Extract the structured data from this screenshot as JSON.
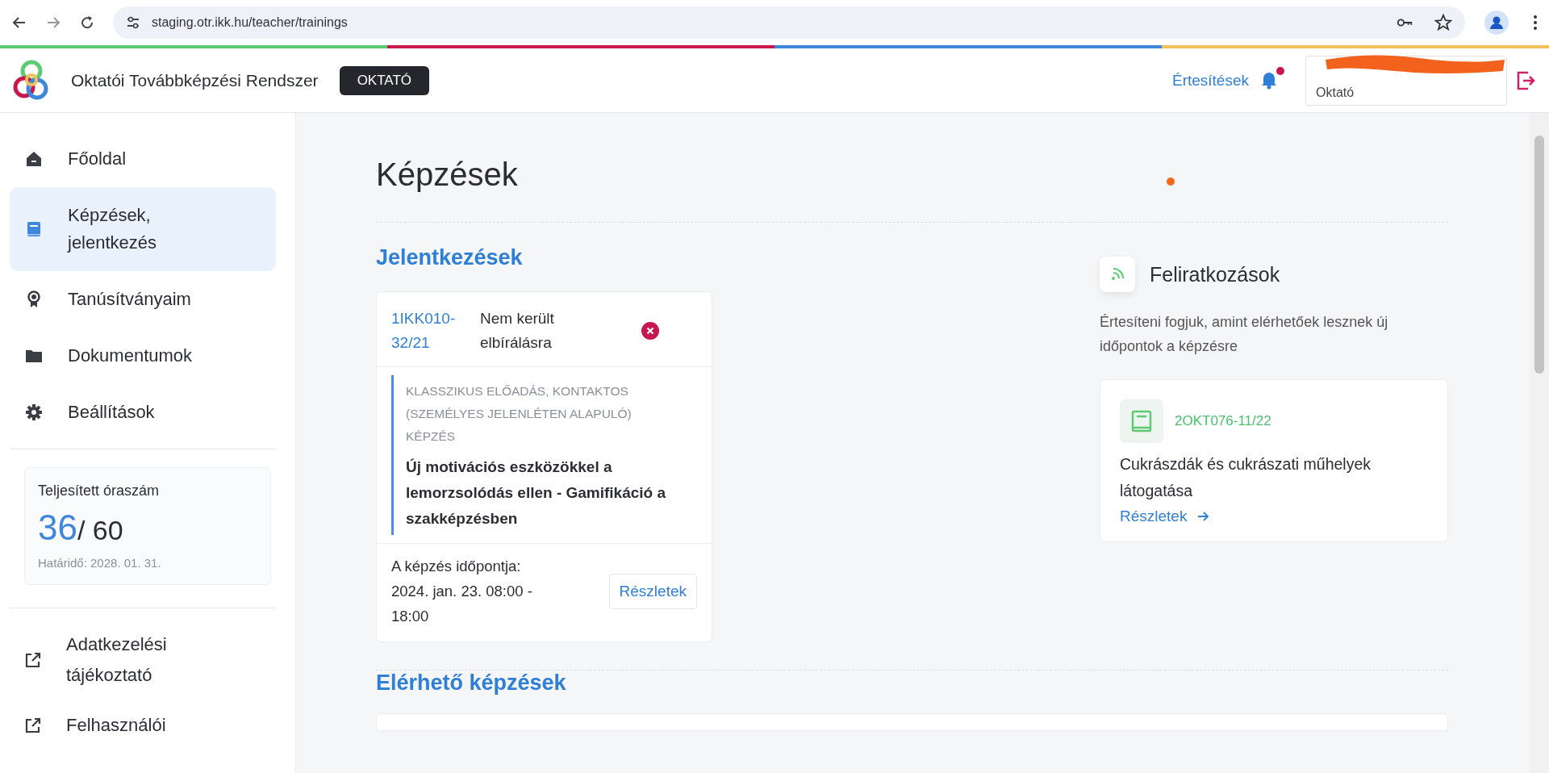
{
  "browser": {
    "url": "staging.otr.ikk.hu/teacher/trainings"
  },
  "header": {
    "app_name": "Oktatói Továbbképzési Rendszer",
    "role_badge": "OKTATÓ",
    "notifications": "Értesítések",
    "unread": true,
    "user_role": "Oktató"
  },
  "sidebar": {
    "items": [
      {
        "kind": "home",
        "label": "Főoldal",
        "selected": false
      },
      {
        "kind": "book",
        "label": "Képzések, jelentkezés",
        "selected": true
      },
      {
        "kind": "award",
        "label": "Tanúsítványaim",
        "selected": false
      },
      {
        "kind": "folder",
        "label": "Dokumentumok",
        "selected": false
      },
      {
        "kind": "gear",
        "label": "Beállítások",
        "selected": false
      }
    ],
    "hours": {
      "title": "Teljesített óraszám",
      "done": "36",
      "total": "/ 60",
      "deadline": "Határidő: 2028. 01. 31."
    },
    "links": [
      {
        "label": "Adatkezelési tájékoztató"
      },
      {
        "label": "Felhasználói"
      }
    ]
  },
  "main": {
    "title": "Képzések",
    "applications": {
      "heading": "Jelentkezések",
      "cards": [
        {
          "code": "1IKK010-32/21",
          "status": "Nem került elbírálásra",
          "type": "KLASSZIKUS ELŐADÁS, KONTAKTOS (SZEMÉLYES JELENLÉTEN ALAPULÓ) KÉPZÉS",
          "title": "Új motivációs eszközökkel a lemorzsolódás ellen - Gamifikáció a szakképzésben",
          "date_label": "A képzés időpontja:",
          "date": "2024. jan. 23. 08:00 - 18:00",
          "button": "Részletek"
        }
      ]
    },
    "subscriptions": {
      "heading": "Feliratkozások",
      "description": "Értesíteni fogjuk, amint elérhetőek lesznek új időpontok a képzésre",
      "items": [
        {
          "code": "2OKT076-11/22",
          "title": "Cukrászdák és cukrászati műhelyek látogatása",
          "link": "Részletek"
        }
      ]
    },
    "available": {
      "heading": "Elérhető képzések"
    }
  }
}
